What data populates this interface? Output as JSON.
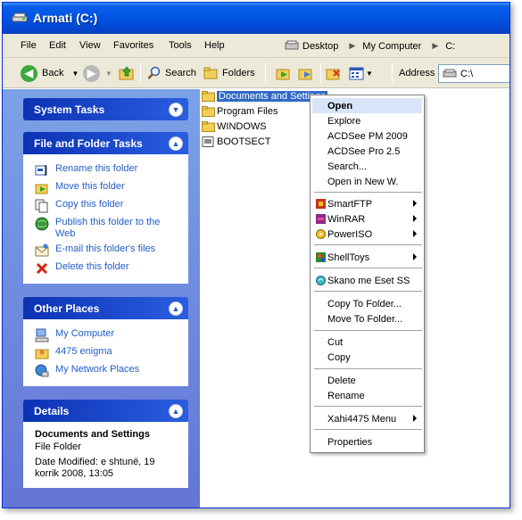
{
  "window": {
    "title": "Armati (C:)"
  },
  "menu": {
    "file": "File",
    "edit": "Edit",
    "view": "View",
    "favorites": "Favorites",
    "tools": "Tools",
    "help": "Help"
  },
  "crumbs": [
    "Desktop",
    "My Computer",
    "C:"
  ],
  "toolbar": {
    "back": "Back",
    "search": "Search",
    "folders": "Folders",
    "address_label": "Address",
    "address_value": "C:\\"
  },
  "system_tasks": {
    "title": "System Tasks"
  },
  "file_tasks": {
    "title": "File and Folder Tasks",
    "items": [
      "Rename this folder",
      "Move this folder",
      "Copy this folder",
      "Publish this folder to the Web",
      "E-mail this folder's files",
      "Delete this folder"
    ]
  },
  "other_places": {
    "title": "Other Places",
    "items": [
      "My Computer",
      "4475 enigma",
      "My Network Places"
    ]
  },
  "details": {
    "title": "Details",
    "name": "Documents and Settings",
    "type": "File Folder",
    "modified": "Date Modified: e shtunë, 19 korrik 2008, 13:05"
  },
  "files": [
    "Documents and Settings",
    "Program Files",
    "WINDOWS",
    "BOOTSECT"
  ],
  "context_menu": {
    "open": "Open",
    "explore": "Explore",
    "acdsee_pm": "ACDSee PM 2009",
    "acdsee_pro": "ACDSee Pro 2.5",
    "search": "Search...",
    "open_new": "Open in New W.",
    "smartftp": "SmartFTP",
    "winrar": "WinRAR",
    "poweriso": "PowerISO",
    "shelltoys": "ShellToys",
    "skano": "Skano me Eset SS",
    "copy_to": "Copy To Folder...",
    "move_to": "Move To Folder...",
    "cut": "Cut",
    "copy": "Copy",
    "delete": "Delete",
    "rename": "Rename",
    "xahi": "Xahi4475 Menu",
    "properties": "Properties"
  },
  "colors": {
    "title_blue": "#0055e5",
    "pane_blue": "#6375d6",
    "link_blue": "#215dc6",
    "selection": "#316ac5"
  }
}
